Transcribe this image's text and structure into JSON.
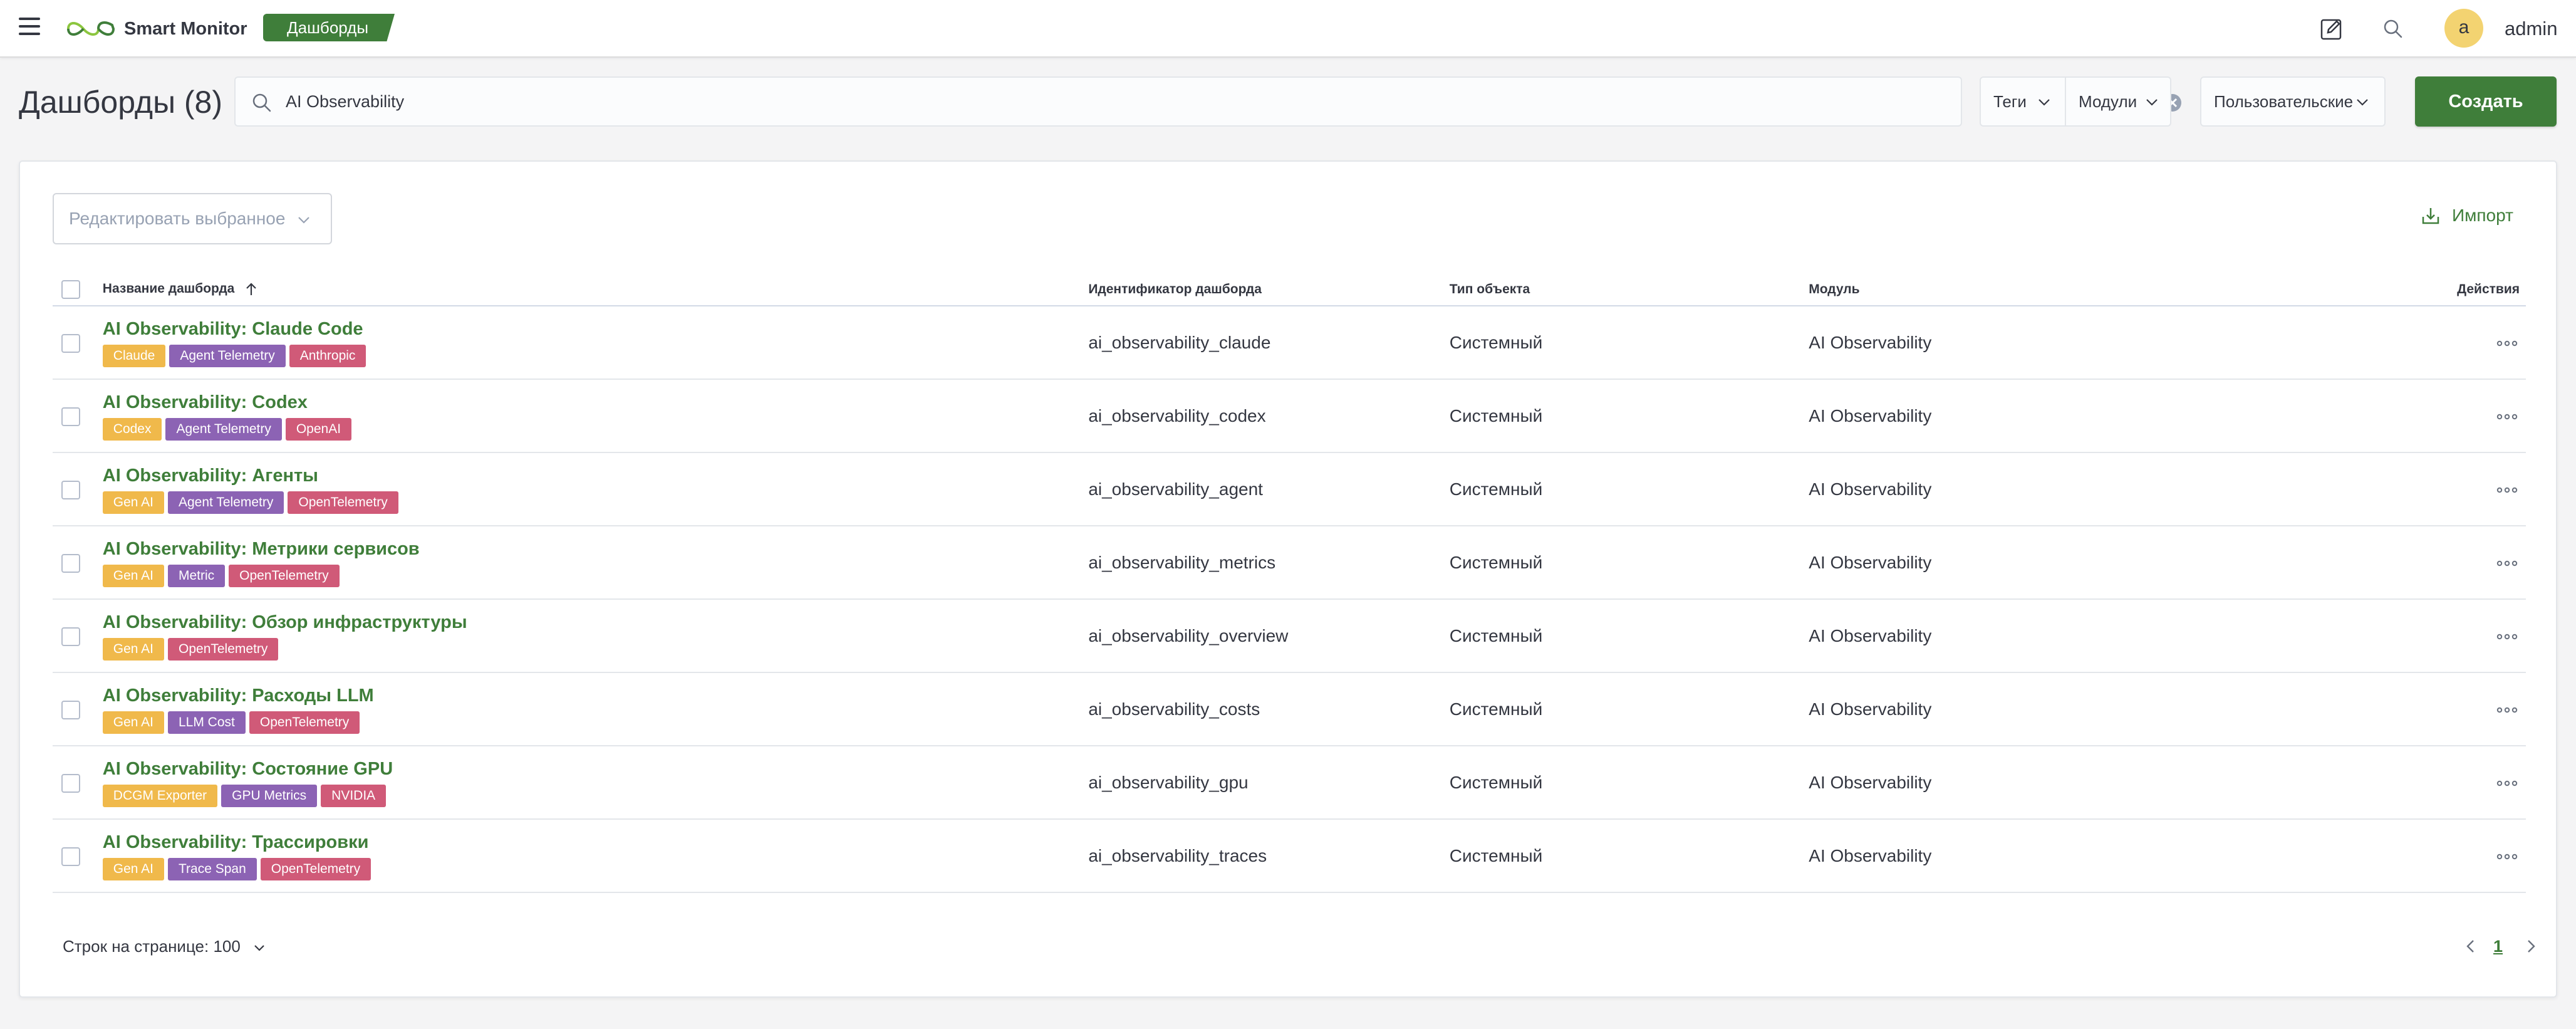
{
  "app": {
    "name": "Smart Monitor",
    "breadcrumb": "Дашборды",
    "user_initial": "a",
    "username": "admin"
  },
  "header": {
    "title": "Дашборды (8)",
    "search_value": "AI Observability",
    "filter_tags": "Теги",
    "filter_modules": "Модули",
    "filter_owner": "Пользовательские",
    "create_label": "Создать"
  },
  "panel": {
    "bulk_edit_placeholder": "Редактировать выбранное",
    "import_label": "Импорт"
  },
  "table": {
    "columns": {
      "name": "Название дашборда",
      "id": "Идентификатор дашборда",
      "type": "Тип объекта",
      "module": "Модуль",
      "actions": "Действия"
    },
    "rows": [
      {
        "title": "AI Observability: Claude Code",
        "id": "ai_observability_claude",
        "type": "Системный",
        "module": "AI Observability",
        "tags": [
          {
            "label": "Claude",
            "color": "#f0b94b"
          },
          {
            "label": "Agent Telemetry",
            "color": "#8c63b4"
          },
          {
            "label": "Anthropic",
            "color": "#d05a78"
          }
        ]
      },
      {
        "title": "AI Observability: Codex",
        "id": "ai_observability_codex",
        "type": "Системный",
        "module": "AI Observability",
        "tags": [
          {
            "label": "Codex",
            "color": "#f0b94b"
          },
          {
            "label": "Agent Telemetry",
            "color": "#8c63b4"
          },
          {
            "label": "OpenAI",
            "color": "#d05a78"
          }
        ]
      },
      {
        "title": "AI Observability: Агенты",
        "id": "ai_observability_agent",
        "type": "Системный",
        "module": "AI Observability",
        "tags": [
          {
            "label": "Gen AI",
            "color": "#f0b94b"
          },
          {
            "label": "Agent Telemetry",
            "color": "#8c63b4"
          },
          {
            "label": "OpenTelemetry",
            "color": "#d05a78"
          }
        ]
      },
      {
        "title": "AI Observability: Метрики сервисов",
        "id": "ai_observability_metrics",
        "type": "Системный",
        "module": "AI Observability",
        "tags": [
          {
            "label": "Gen AI",
            "color": "#f0b94b"
          },
          {
            "label": "Metric",
            "color": "#8c63b4"
          },
          {
            "label": "OpenTelemetry",
            "color": "#d05a78"
          }
        ]
      },
      {
        "title": "AI Observability: Обзор инфраструктуры",
        "id": "ai_observability_overview",
        "type": "Системный",
        "module": "AI Observability",
        "tags": [
          {
            "label": "Gen AI",
            "color": "#f0b94b"
          },
          {
            "label": "OpenTelemetry",
            "color": "#d05a78"
          }
        ]
      },
      {
        "title": "AI Observability: Расходы LLM",
        "id": "ai_observability_costs",
        "type": "Системный",
        "module": "AI Observability",
        "tags": [
          {
            "label": "Gen AI",
            "color": "#f0b94b"
          },
          {
            "label": "LLM Cost",
            "color": "#8c63b4"
          },
          {
            "label": "OpenTelemetry",
            "color": "#d05a78"
          }
        ]
      },
      {
        "title": "AI Observability: Состояние GPU",
        "id": "ai_observability_gpu",
        "type": "Системный",
        "module": "AI Observability",
        "tags": [
          {
            "label": "DCGM Exporter",
            "color": "#f0b94b"
          },
          {
            "label": "GPU Metrics",
            "color": "#8c63b4"
          },
          {
            "label": "NVIDIA",
            "color": "#d05a78"
          }
        ]
      },
      {
        "title": "AI Observability: Трассировки",
        "id": "ai_observability_traces",
        "type": "Системный",
        "module": "AI Observability",
        "tags": [
          {
            "label": "Gen AI",
            "color": "#f0b94b"
          },
          {
            "label": "Trace Span",
            "color": "#8c63b4"
          },
          {
            "label": "OpenTelemetry",
            "color": "#d05a78"
          }
        ]
      }
    ]
  },
  "footer": {
    "rows_per_page": "Строк на странице: 100",
    "current_page": "1"
  },
  "icons": {
    "menu": "hamburger-icon",
    "logo": "infinity-logo-icon",
    "edit": "edit-note-icon",
    "search": "search-icon",
    "clear": "clear-icon",
    "chevron": "chevron-down-icon",
    "import": "download-icon",
    "sort": "sort-up-icon",
    "actions": "more-dots-icon"
  },
  "colors": {
    "accent": "#3f7e3a",
    "tag_yellow": "#f0b94b",
    "tag_purple": "#8c63b4",
    "tag_pink": "#d05a78"
  }
}
